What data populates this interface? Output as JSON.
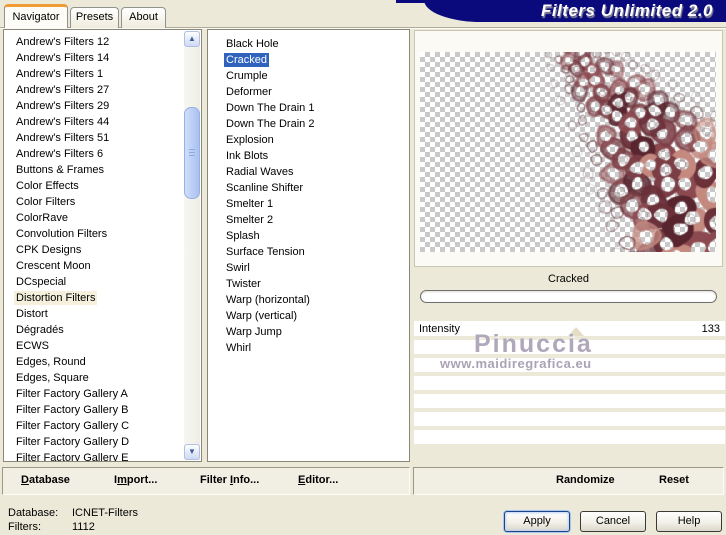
{
  "title_banner": {
    "text": "Filters Unlimited 2.0"
  },
  "tabs": [
    {
      "label": "Navigator",
      "active": true
    },
    {
      "label": "Presets",
      "active": false
    },
    {
      "label": "About",
      "active": false
    }
  ],
  "category_list": {
    "selected": "Distortion Filters",
    "items": [
      "Andrew's Filters 12",
      "Andrew's Filters 14",
      "Andrew's Filters 1",
      "Andrew's Filters 27",
      "Andrew's Filters 29",
      "Andrew's Filters 44",
      "Andrew's Filters 51",
      "Andrew's Filters 6",
      "Buttons & Frames",
      "Color Effects",
      "Color Filters",
      "ColorRave",
      "Convolution Filters",
      "CPK Designs",
      "Crescent Moon",
      "DCspecial",
      "Distortion Filters",
      "Distort",
      "Dégradés",
      "ECWS",
      "Edges, Round",
      "Edges, Square",
      "Filter Factory Gallery A",
      "Filter Factory Gallery B",
      "Filter Factory Gallery C",
      "Filter Factory Gallery D",
      "Filter Factory Gallery E"
    ]
  },
  "filter_list": {
    "selected": "Cracked",
    "items": [
      "Black Hole",
      "Cracked",
      "Crumple",
      "Deformer",
      "Down The Drain 1",
      "Down The Drain 2",
      "Explosion",
      "Ink Blots",
      "Radial Waves",
      "Scanline Shifter",
      "Smelter 1",
      "Smelter 2",
      "Splash",
      "Surface Tension",
      "Swirl",
      "Twister",
      "Warp (horizontal)",
      "Warp (vertical)",
      "Warp Jump",
      "Whirl"
    ]
  },
  "preview": {
    "filter_name": "Cracked",
    "watermark": {
      "line1": "Pinuccia",
      "line2": "www.maidiregrafica.eu"
    },
    "texture": {
      "stroke": "#5c2830",
      "fill_dark": "#59252e",
      "fill_mid": "#8c4a50",
      "fill_light": "#c4897f",
      "checker_gray": "#c9c9c9"
    }
  },
  "controls": {
    "slider": {
      "label": "Intensity",
      "value": "133",
      "position_pct": 52
    },
    "empty_rows": 6
  },
  "action_bar": {
    "left": [
      {
        "label": "Database",
        "accel_index": 0
      },
      {
        "label": "Import...",
        "accel_index": 1
      },
      {
        "label": "Filter Info...",
        "accel_index": 7
      },
      {
        "label": "Editor...",
        "accel_index": 0
      }
    ],
    "right": [
      {
        "label": "Randomize",
        "accel_index": null
      },
      {
        "label": "Reset",
        "accel_index": null
      }
    ]
  },
  "status": {
    "database_label": "Database:",
    "database_value": "ICNET-Filters",
    "filters_label": "Filters:",
    "filters_value": "1112"
  },
  "dialog_buttons": [
    {
      "label": "Apply",
      "default": true
    },
    {
      "label": "Cancel",
      "default": false
    },
    {
      "label": "Help",
      "default": false
    }
  ]
}
